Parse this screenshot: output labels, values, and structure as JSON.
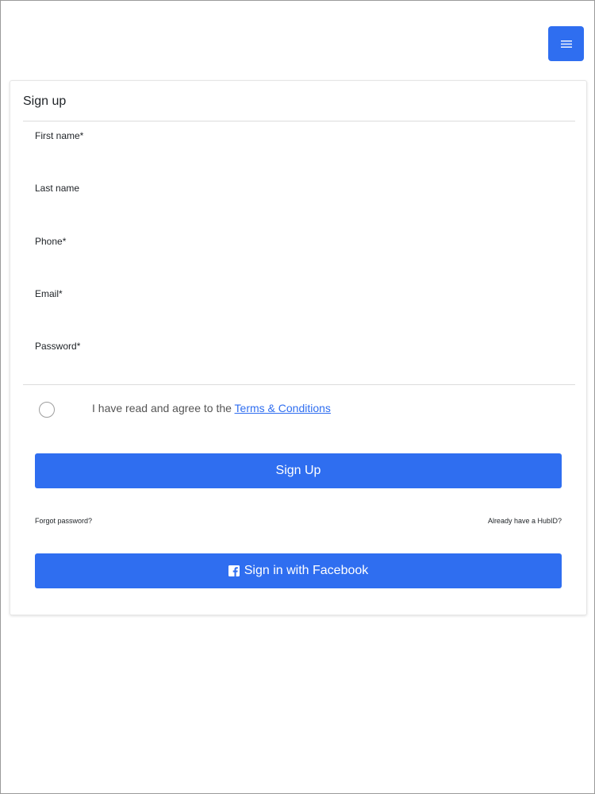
{
  "header": {
    "menu_icon": "hamburger-menu-icon"
  },
  "form": {
    "title": "Sign up",
    "fields": [
      {
        "label": "First name*",
        "value": ""
      },
      {
        "label": "Last name",
        "value": ""
      },
      {
        "label": "Phone*",
        "value": ""
      },
      {
        "label": "Email*",
        "value": ""
      },
      {
        "label": "Password*",
        "value": ""
      }
    ],
    "agree_text": "I have read and agree to the ",
    "terms_link": "Terms & Conditions",
    "signup_button": "Sign Up",
    "forgot_password": "Forgot password?",
    "already_have": "Already have a HubID?",
    "facebook_button": "Sign in with Facebook",
    "facebook_icon": "facebook-icon"
  },
  "colors": {
    "accent": "#2f6ef0"
  }
}
